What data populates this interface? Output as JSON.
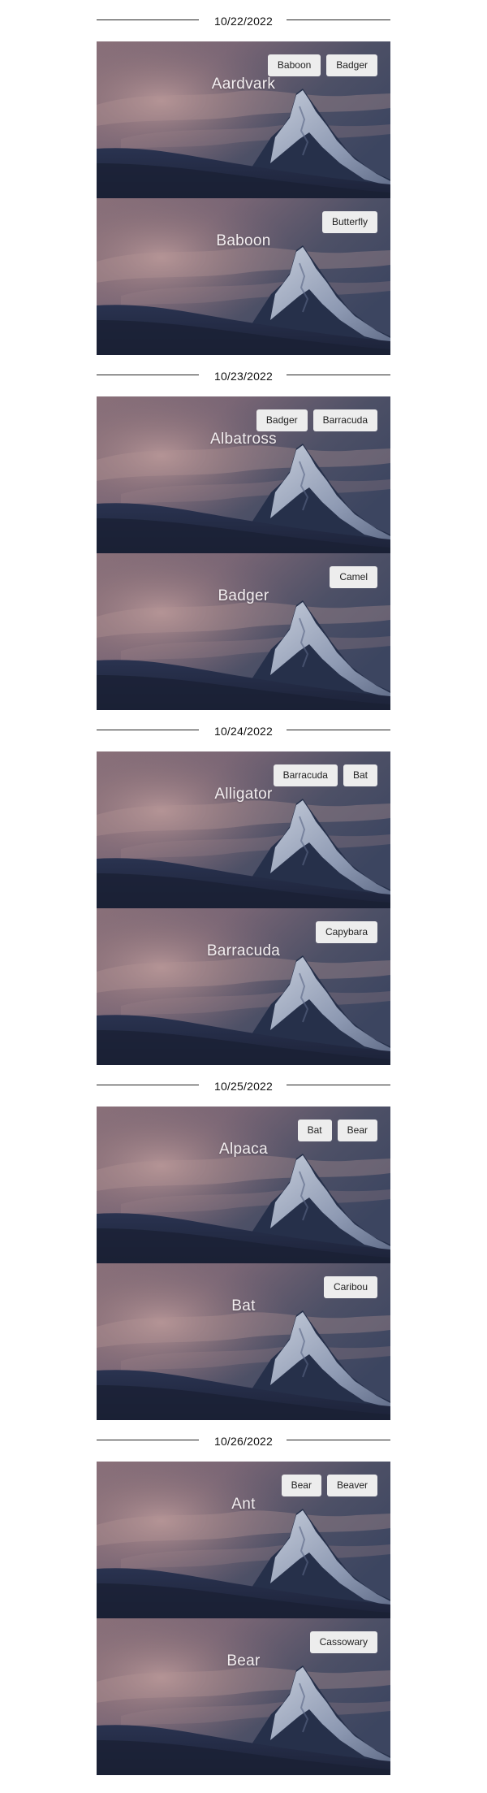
{
  "groups": [
    {
      "date": "10/22/2022",
      "cards": [
        {
          "title": "Aardvark",
          "tags": [
            "Baboon",
            "Badger"
          ]
        },
        {
          "title": "Baboon",
          "tags": [
            "Butterfly"
          ]
        }
      ]
    },
    {
      "date": "10/23/2022",
      "cards": [
        {
          "title": "Albatross",
          "tags": [
            "Badger",
            "Barracuda"
          ]
        },
        {
          "title": "Badger",
          "tags": [
            "Camel"
          ]
        }
      ]
    },
    {
      "date": "10/24/2022",
      "cards": [
        {
          "title": "Alligator",
          "tags": [
            "Barracuda",
            "Bat"
          ]
        },
        {
          "title": "Barracuda",
          "tags": [
            "Capybara"
          ]
        }
      ]
    },
    {
      "date": "10/25/2022",
      "cards": [
        {
          "title": "Alpaca",
          "tags": [
            "Bat",
            "Bear"
          ]
        },
        {
          "title": "Bat",
          "tags": [
            "Caribou"
          ]
        }
      ]
    },
    {
      "date": "10/26/2022",
      "cards": [
        {
          "title": "Ant",
          "tags": [
            "Bear",
            "Beaver"
          ]
        },
        {
          "title": "Bear",
          "tags": [
            "Cassowary"
          ]
        }
      ]
    }
  ]
}
